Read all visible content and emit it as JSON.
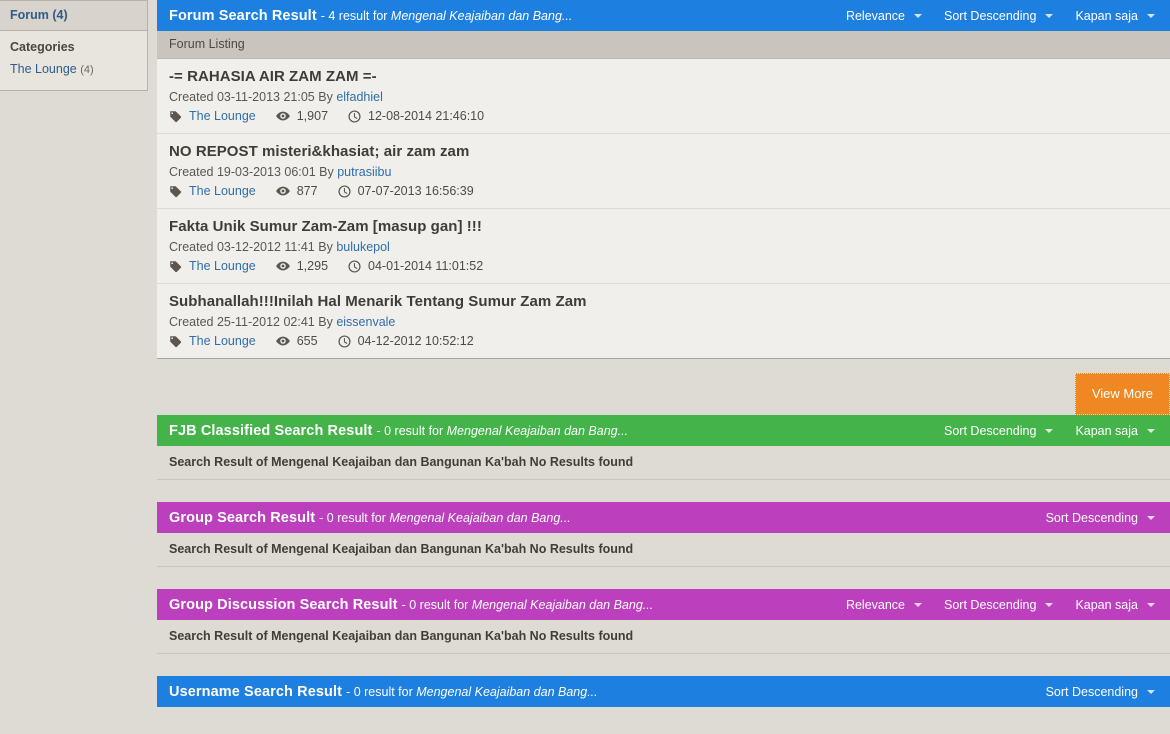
{
  "sidebar": {
    "header": "Forum (4)",
    "section_title": "Categories",
    "items": [
      {
        "label": "The Lounge",
        "count": "(4)"
      }
    ]
  },
  "colors": {
    "forum_bar": "#1d7fe0",
    "fjb_bar": "#44b349",
    "group_bar": "#bc3fbd",
    "view_more_button": "#ef8722",
    "page_background": "#dedbd5"
  },
  "query": "Mengenal Keajaiban dan Bangunan Ka'bah",
  "sections": {
    "forum": {
      "title": "Forum Search Result",
      "subtitle": "- 4 result for ",
      "query_short": "Mengenal Keajaiban dan Bang...",
      "dropdowns": [
        {
          "label": "Relevance"
        },
        {
          "label": "Sort Descending"
        },
        {
          "label": "Kapan saja"
        }
      ],
      "listing_label": "Forum Listing",
      "view_more": "View More",
      "items": [
        {
          "title": "-= RAHASIA AIR ZAM ZAM =-",
          "created_label": "Created",
          "created": "03-11-2013 21:05",
          "by_label": "By",
          "author": "elfadhiel",
          "category": "The Lounge",
          "views": "1,907",
          "last_post": "12-08-2014 21:46:10"
        },
        {
          "title": "NO REPOST misteri&khasiat; air zam zam",
          "created_label": "Created",
          "created": "19-03-2013 06:01",
          "by_label": "By",
          "author": "putrasiibu",
          "category": "The Lounge",
          "views": "877",
          "last_post": "07-07-2013 16:56:39"
        },
        {
          "title": "Fakta Unik Sumur Zam-Zam [masup gan] !!!",
          "created_label": "Created",
          "created": "03-12-2012 11:41",
          "by_label": "By",
          "author": "bulukepol",
          "category": "The Lounge",
          "views": "1,295",
          "last_post": "04-01-2014 11:01:52"
        },
        {
          "title": "Subhanallah!!!Inilah Hal Menarik Tentang Sumur Zam Zam",
          "created_label": "Created",
          "created": "25-11-2012 02:41",
          "by_label": "By",
          "author": "eissenvale",
          "category": "The Lounge",
          "views": "655",
          "last_post": "04-12-2012 10:52:12"
        }
      ]
    },
    "fjb": {
      "title": "FJB Classified Search Result",
      "subtitle": "- 0 result for ",
      "query_short": "Mengenal Keajaiban dan Bang...",
      "dropdowns": [
        {
          "label": "Sort Descending"
        },
        {
          "label": "Kapan saja"
        }
      ],
      "no_results": "Search Result of Mengenal Keajaiban dan Bangunan Ka'bah No Results found"
    },
    "group": {
      "title": "Group Search Result",
      "subtitle": "- 0 result for ",
      "query_short": "Mengenal Keajaiban dan Bang...",
      "dropdowns": [
        {
          "label": "Sort Descending"
        }
      ],
      "no_results": "Search Result of Mengenal Keajaiban dan Bangunan Ka'bah No Results found"
    },
    "group_discussion": {
      "title": "Group Discussion Search Result",
      "subtitle": "- 0 result for ",
      "query_short": "Mengenal Keajaiban dan Bang...",
      "dropdowns": [
        {
          "label": "Relevance"
        },
        {
          "label": "Sort Descending"
        },
        {
          "label": "Kapan saja"
        }
      ],
      "no_results": "Search Result of Mengenal Keajaiban dan Bangunan Ka'bah No Results found"
    },
    "username": {
      "title": "Username Search Result",
      "subtitle": "- 0 result for ",
      "query_short": "Mengenal Keajaiban dan Bang...",
      "dropdowns": [
        {
          "label": "Sort Descending"
        }
      ]
    }
  }
}
